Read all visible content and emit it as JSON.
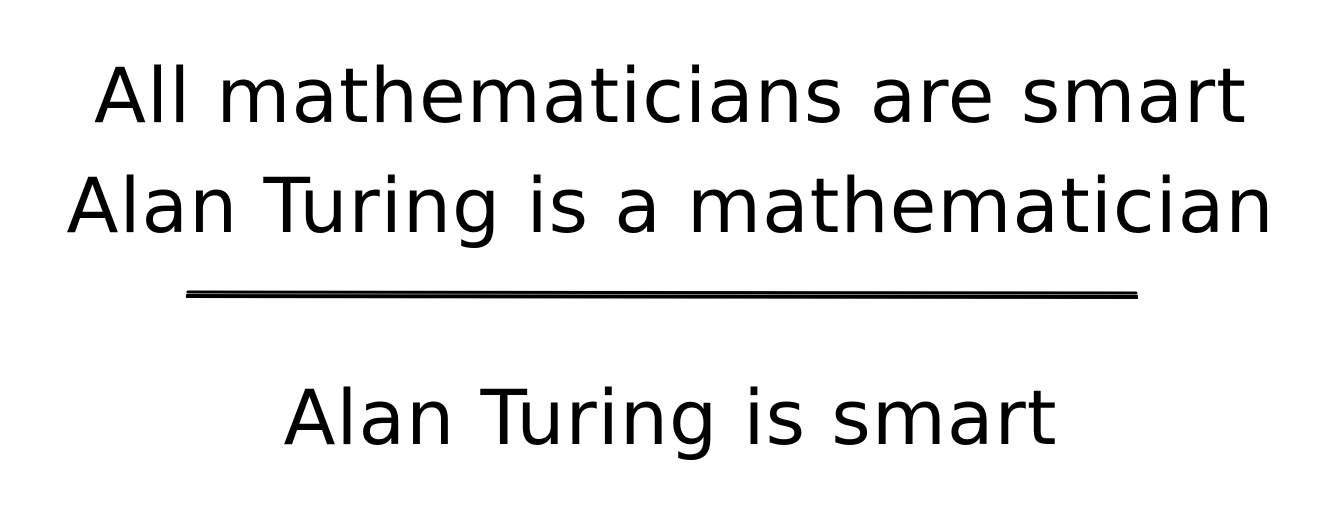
{
  "syllogism": {
    "premises": [
      "All mathematicians are smart",
      "Alan Turing is a mathematician"
    ],
    "conclusion": "Alan Turing is smart"
  },
  "colors": {
    "ink": "#000000",
    "background": "#ffffff"
  }
}
